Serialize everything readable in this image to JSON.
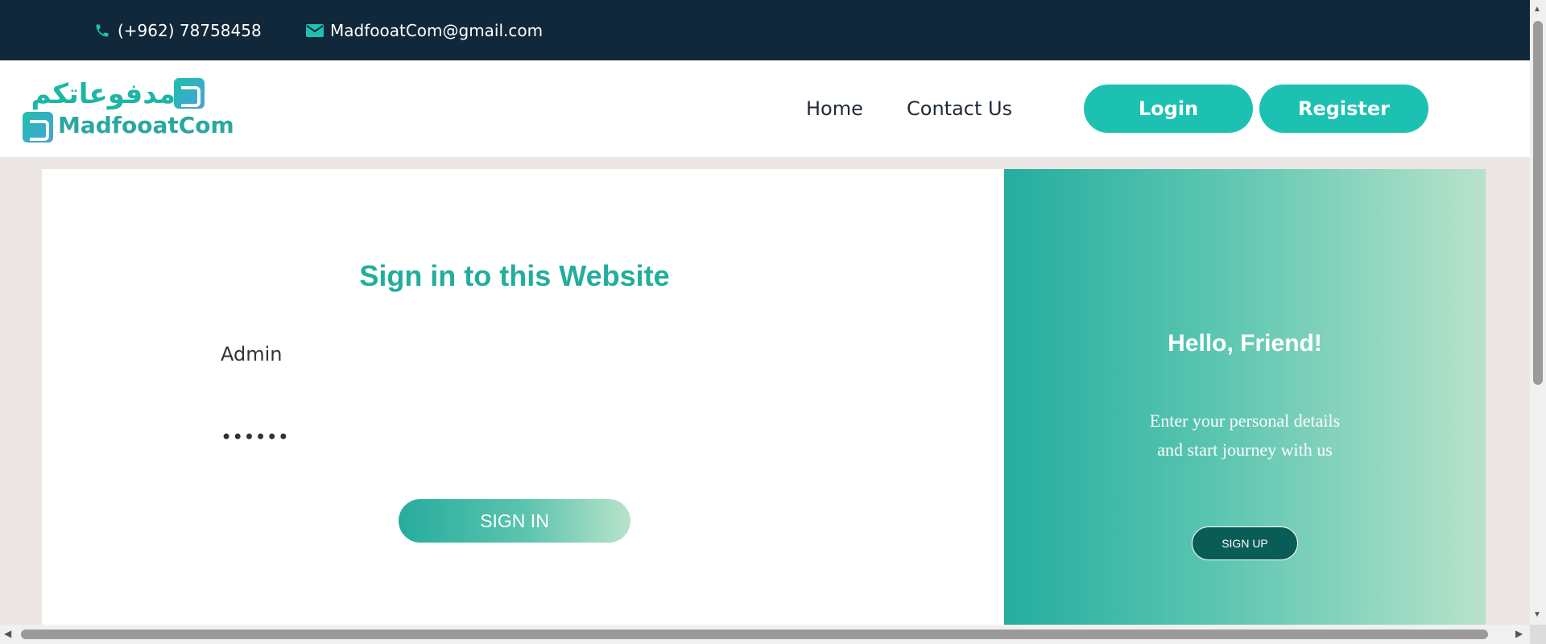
{
  "topbar": {
    "phone": "(+962) 78758458",
    "email": "MadfooatCom@gmail.com",
    "phone_icon": "phone-icon",
    "email_icon": "envelope-icon"
  },
  "brand": {
    "arabic_name": "مدفوعاتكم",
    "english_name": "MadfooatCom"
  },
  "nav": {
    "home": "Home",
    "contact": "Contact Us",
    "login": "Login",
    "register": "Register"
  },
  "signin_form": {
    "title": "Sign in to this Website",
    "username_value": "Admin",
    "password_value": "••••••",
    "submit_label": "SIGN IN"
  },
  "side_panel": {
    "heading": "Hello, Friend!",
    "message_line1": "Enter your personal details",
    "message_line2": "and start journey with us",
    "signup_label": "SIGN UP"
  },
  "colors": {
    "accent": "#1dc1b2",
    "topbar_bg": "#11283a",
    "title_color": "#22ad9c"
  }
}
